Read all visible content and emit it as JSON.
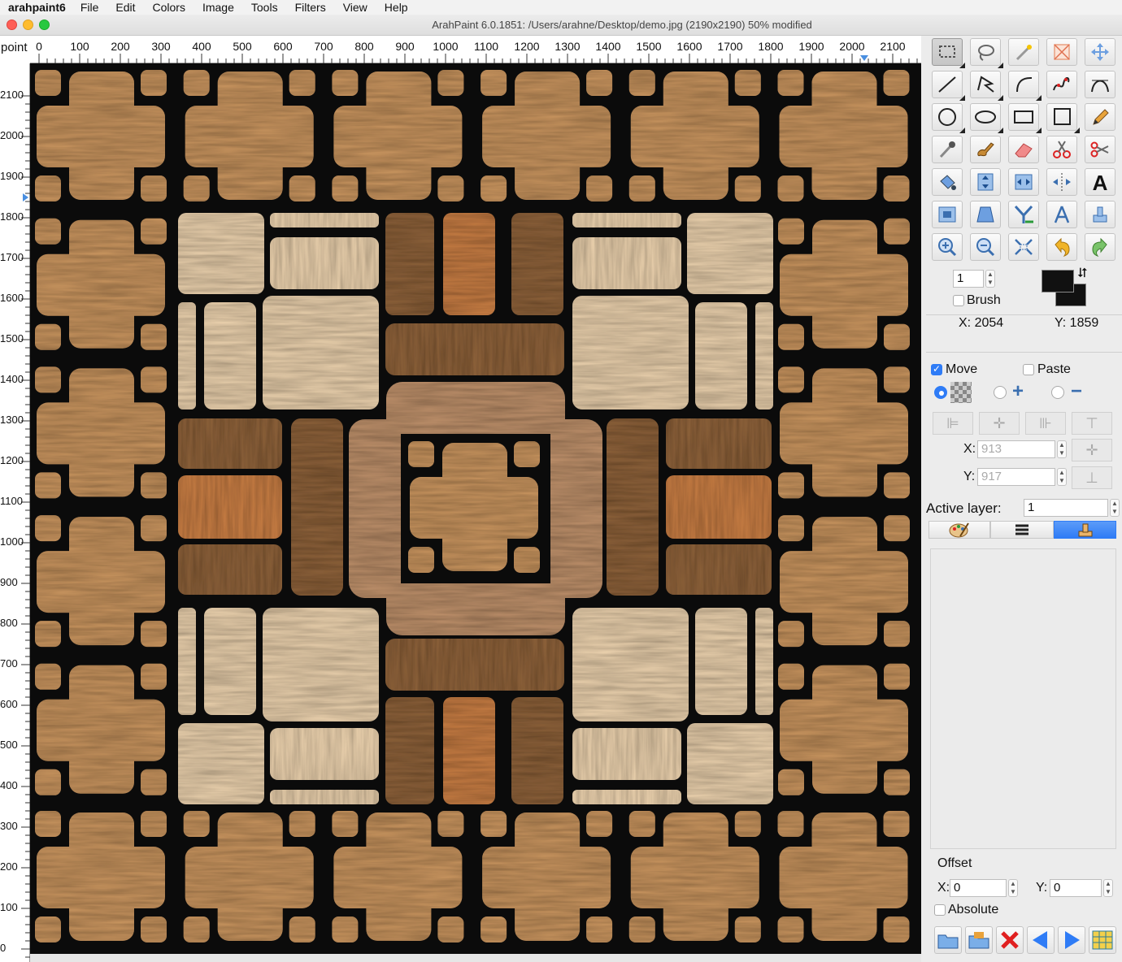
{
  "menubar": {
    "app_name": "arahpaint6",
    "items": [
      "File",
      "Edit",
      "Colors",
      "Image",
      "Tools",
      "Filters",
      "View",
      "Help"
    ]
  },
  "window": {
    "title": "ArahPaint 6.0.1851: /Users/arahne/Desktop/demo.jpg  (2190x2190) 50% modified"
  },
  "rulers": {
    "unit": "point",
    "horizontal": [
      "0",
      "100",
      "200",
      "300",
      "400",
      "500",
      "600",
      "700",
      "800",
      "900",
      "1000",
      "1100",
      "1200",
      "1300",
      "1400",
      "1500",
      "1600",
      "1700",
      "1800",
      "1900",
      "2000",
      "2100"
    ],
    "vertical": [
      "2100",
      "2000",
      "1900",
      "1800",
      "1700",
      "1600",
      "1500",
      "1400",
      "1300",
      "1200",
      "1100",
      "1000",
      "900",
      "800",
      "700",
      "600",
      "500",
      "400",
      "300",
      "200",
      "100",
      "0"
    ]
  },
  "toolbox": {
    "tools": [
      "rect-select",
      "lasso",
      "magic-wand",
      "crop",
      "move",
      "line",
      "polygon",
      "arc",
      "freehand-curve",
      "bezier",
      "circle",
      "ellipse",
      "rectangle",
      "square",
      "pencil",
      "eyedropper",
      "brush",
      "eraser",
      "scissors",
      "cut-pattern",
      "paint-bucket",
      "flip-vertical",
      "flip-horizontal",
      "mirror-move",
      "text",
      "resize-canvas",
      "perspective",
      "y-fork",
      "compass",
      "stamp",
      "zoom-in",
      "zoom-out",
      "fit-window",
      "undo",
      "redo"
    ],
    "brush_size": "1",
    "brush_label": "Brush",
    "foreground_color": "#111111",
    "background_color": "#111111",
    "cursor_x": "X: 2054",
    "cursor_y": "Y: 1859"
  },
  "move_panel": {
    "move_label": "Move",
    "move_checked": true,
    "paste_label": "Paste",
    "paste_checked": false,
    "x_label": "X:",
    "x_value": "913",
    "y_label": "Y:",
    "y_value": "917"
  },
  "layers": {
    "active_layer_label": "Active layer:",
    "active_layer_value": "1"
  },
  "offset": {
    "title": "Offset",
    "x_label": "X:",
    "x_value": "0",
    "y_label": "Y:",
    "y_value": "0",
    "absolute_label": "Absolute"
  },
  "colors": {
    "accent": "#2f7cf6",
    "canvas_bg": "#0b0b0b",
    "wood_medium": "#c9955f",
    "wood_light": "#ecd2ae",
    "wood_dark": "#8e623a",
    "wood_orange": "#c97e44",
    "wood_center": "#bf916b"
  }
}
